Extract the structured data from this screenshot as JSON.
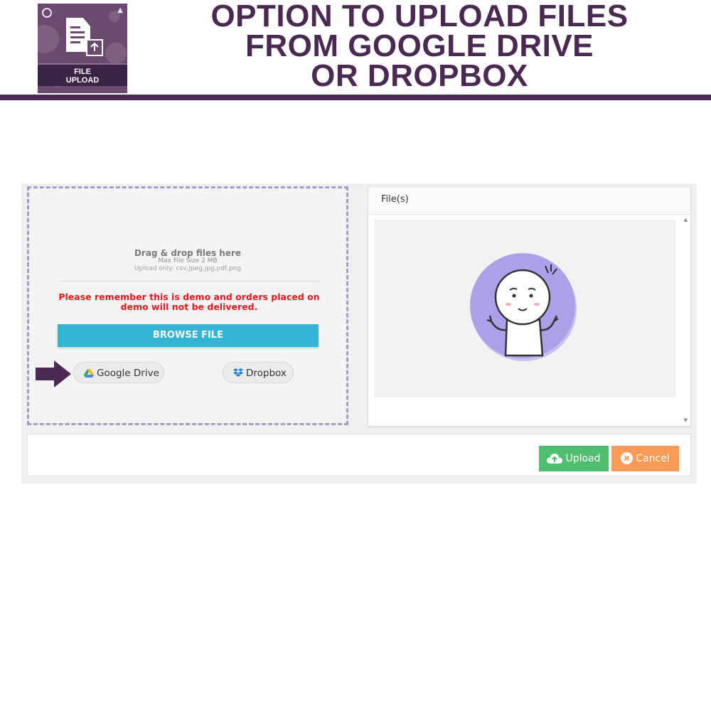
{
  "header": {
    "logo_label": "FILE\nUPLOAD",
    "headline_lines": [
      "OPTION TO UPLOAD FILES",
      "FROM GOOGLE DRIVE",
      "OR DROPBOX"
    ]
  },
  "dropzone": {
    "title": "Drag & drop files here",
    "max_size": "Max File Size 2 MB",
    "allowed_types": "Upload only: csv,jpeg,jpg,pdf,png",
    "warning": "Please remember this is demo and orders placed on demo will not be delivered.",
    "browse_label": "BROWSE FILE",
    "google_drive_label": "Google Drive",
    "dropbox_label": "Dropbox"
  },
  "files_panel": {
    "title": "File(s)"
  },
  "actions": {
    "upload_label": "Upload",
    "cancel_label": "Cancel"
  },
  "colors": {
    "brand_purple": "#4a2a52",
    "browse_blue": "#31b5d3",
    "upload_green": "#4dbf6d",
    "cancel_orange": "#f99a55",
    "warning_red": "#e8161c",
    "dropzone_border": "#a69bc8"
  },
  "icons": {
    "logo": "file-upload-logo",
    "arrow": "arrow-right-icon",
    "google_drive": "google-drive-icon",
    "dropbox": "dropbox-icon",
    "upload": "cloud-upload-icon",
    "cancel": "close-circle-icon",
    "empty_state": "empty-files-illustration"
  }
}
